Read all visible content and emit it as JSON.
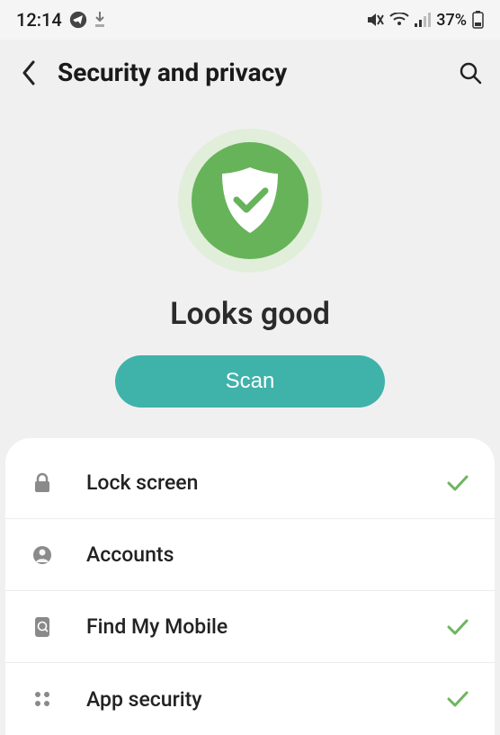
{
  "statusbar": {
    "time": "12:14",
    "battery_pct": "37%"
  },
  "header": {
    "title": "Security and privacy"
  },
  "hero": {
    "status_text": "Looks good",
    "scan_label": "Scan"
  },
  "list": {
    "items": [
      {
        "icon": "lock",
        "label": "Lock screen",
        "checked": true
      },
      {
        "icon": "account",
        "label": "Accounts",
        "checked": false
      },
      {
        "icon": "locate",
        "label": "Find My Mobile",
        "checked": true
      },
      {
        "icon": "apps",
        "label": "App security",
        "checked": true
      }
    ]
  },
  "colors": {
    "accent_green": "#67b35a",
    "accent_teal": "#3fb2aa",
    "check_green": "#6eb560"
  }
}
